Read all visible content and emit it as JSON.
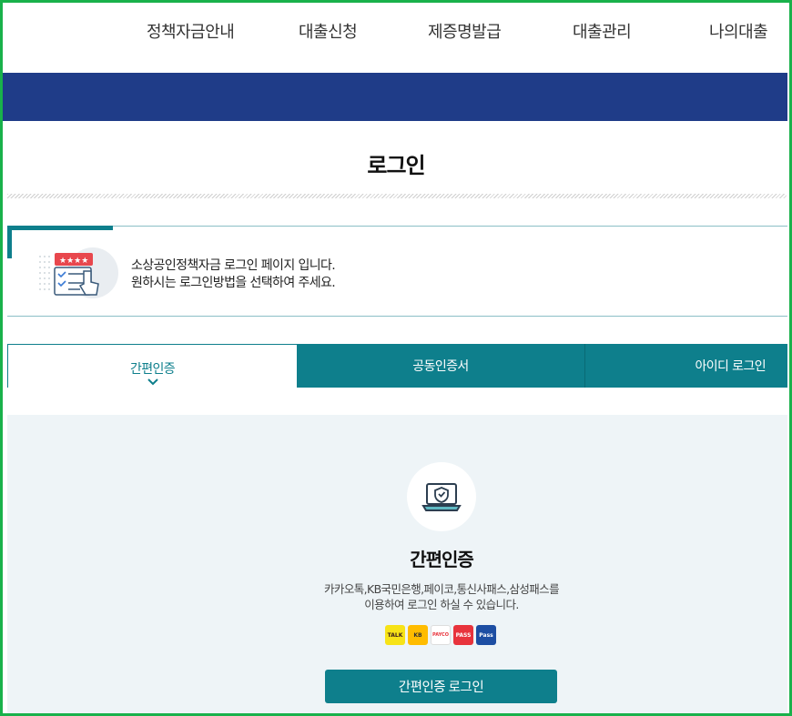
{
  "nav": {
    "items": [
      {
        "label": "정책자금안내"
      },
      {
        "label": "대출신청"
      },
      {
        "label": "제증명발급"
      },
      {
        "label": "대출관리"
      },
      {
        "label": "나의대출"
      }
    ]
  },
  "page": {
    "title": "로그인"
  },
  "intro": {
    "line1": "소상공인정책자금 로그인 페이지 입니다.",
    "line2": "원하시는 로그인방법을 선택하여 주세요."
  },
  "tabs": [
    {
      "label": "간편인증",
      "active": true
    },
    {
      "label": "공동인증서",
      "active": false
    },
    {
      "label": "아이디 로그인",
      "active": false
    }
  ],
  "panel": {
    "title": "간편인증",
    "desc_line1": "카카오톡,KB국민은행,페이코,통신사패스,삼성패스를",
    "desc_line2": "이용하여 로그인 하실 수 있습니다.",
    "providers": [
      {
        "name": "kakao-talk-icon",
        "text": "TALK",
        "color": "#f7e317"
      },
      {
        "name": "kb-icon",
        "text": "KB",
        "color": "#ffbc00"
      },
      {
        "name": "payco-icon",
        "text": "PAYCO",
        "color": "#ffffff"
      },
      {
        "name": "pass-icon",
        "text": "PASS",
        "color": "#e8333c"
      },
      {
        "name": "samsung-pass-icon",
        "text": "Pass",
        "color": "#1d4ea3"
      }
    ],
    "button_label": "간편인증 로그인"
  },
  "colors": {
    "brand_navy": "#1f3c88",
    "teal": "#0e7f8c",
    "panel_bg": "#eef4f7"
  }
}
